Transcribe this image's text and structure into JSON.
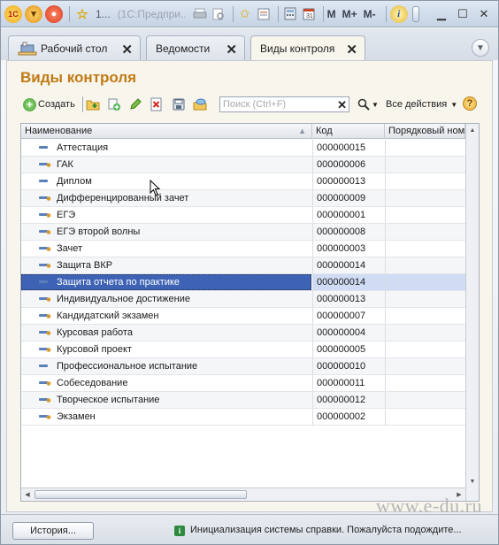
{
  "titlebar": {
    "counter": "1...",
    "title": "(1С:Предпри..",
    "m_label": "M",
    "m_plus_label": "M+",
    "m_minus_label": "M-"
  },
  "tabs": [
    {
      "label": "Рабочий стол",
      "active": false
    },
    {
      "label": "Ведомости",
      "active": false
    },
    {
      "label": "Виды контроля",
      "active": true
    }
  ],
  "page": {
    "title": "Виды контроля"
  },
  "toolbar": {
    "create_label": "Создать",
    "search_placeholder": "Поиск (Ctrl+F)",
    "all_actions_label": "Все действия",
    "help_label": "?"
  },
  "table": {
    "columns": [
      "Наименование",
      "Код",
      "Порядковый ном"
    ],
    "rows": [
      {
        "name": "Аттестация",
        "code": "000000015",
        "type": "plain"
      },
      {
        "name": "ГАК",
        "code": "000000006",
        "type": "marked"
      },
      {
        "name": "Диплом",
        "code": "000000013",
        "type": "plain"
      },
      {
        "name": "Дифференцированный зачет",
        "code": "000000009",
        "type": "marked"
      },
      {
        "name": "ЕГЭ",
        "code": "000000001",
        "type": "marked"
      },
      {
        "name": "ЕГЭ второй волны",
        "code": "000000008",
        "type": "marked"
      },
      {
        "name": "Зачет",
        "code": "000000003",
        "type": "marked"
      },
      {
        "name": "Защита ВКР",
        "code": "000000014",
        "type": "marked"
      },
      {
        "name": "Защита отчета по практике",
        "code": "000000014",
        "type": "plain",
        "selected": true
      },
      {
        "name": "Индивидуальное достижение",
        "code": "000000013",
        "type": "marked"
      },
      {
        "name": "Кандидатский экзамен",
        "code": "000000007",
        "type": "marked"
      },
      {
        "name": "Курсовая работа",
        "code": "000000004",
        "type": "marked"
      },
      {
        "name": "Курсовой проект",
        "code": "000000005",
        "type": "marked"
      },
      {
        "name": "Профессиональное испытание",
        "code": "000000010",
        "type": "plain"
      },
      {
        "name": "Собеседование",
        "code": "000000011",
        "type": "marked"
      },
      {
        "name": "Творческое испытание",
        "code": "000000012",
        "type": "marked"
      },
      {
        "name": "Экзамен",
        "code": "000000002",
        "type": "marked"
      }
    ]
  },
  "statusbar": {
    "history_label": "История...",
    "message": "Инициализация системы справки. Пожалуйста подождите..."
  },
  "watermark": "www.e-du.ru",
  "colors": {
    "title_accent": "#c07a15",
    "selection": "#3e63b5",
    "row_icon_plain": "#5b7fb8",
    "row_icon_marked": "#d99a2b"
  }
}
